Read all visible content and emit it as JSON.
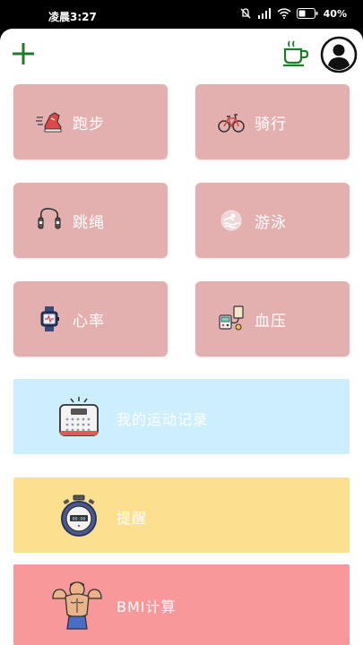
{
  "status_bar": {
    "time": "凌晨3:27",
    "battery": "40%"
  },
  "toolbar": {
    "add_icon": "plus-icon",
    "coffee_icon": "coffee-cup-icon",
    "avatar_icon": "user-avatar-icon"
  },
  "colors": {
    "card_pink": "#e4afaf",
    "records_blue": "#cdeefc",
    "reminder_yellow": "#fddf90",
    "bmi_red": "#f8989a",
    "accent_green": "#1f7a2a"
  },
  "sports": [
    {
      "label": "跑步",
      "icon": "running-shoe-icon"
    },
    {
      "label": "骑行",
      "icon": "bicycle-icon"
    },
    {
      "label": "跳绳",
      "icon": "jump-rope-icon"
    },
    {
      "label": "游泳",
      "icon": "swimming-icon"
    },
    {
      "label": "心率",
      "icon": "smartwatch-icon"
    },
    {
      "label": "血压",
      "icon": "blood-pressure-monitor-icon"
    }
  ],
  "features": [
    {
      "label": "我的运动记录",
      "icon": "scale-record-icon"
    },
    {
      "label": "提醒",
      "icon": "stopwatch-icon"
    },
    {
      "label": "BMI计算",
      "icon": "bodybuilder-icon"
    }
  ]
}
